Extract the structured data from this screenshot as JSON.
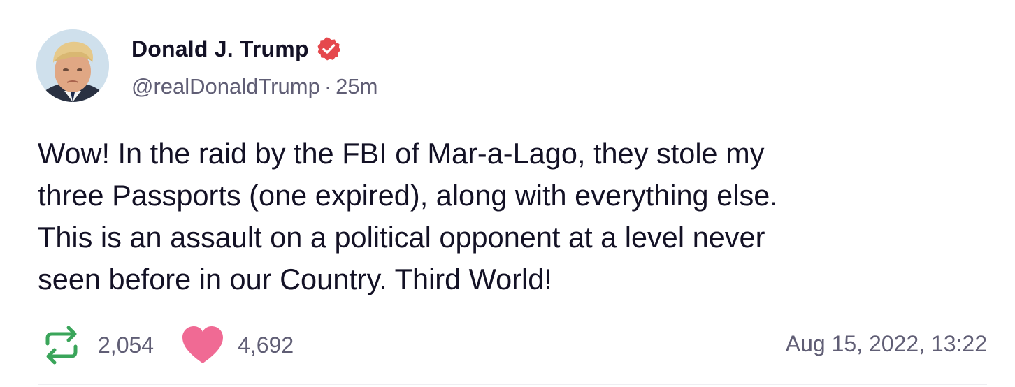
{
  "post": {
    "author": {
      "display_name": "Donald J. Trump",
      "handle": "@realDonaldTrump",
      "verified": true,
      "verified_icon": "verified-badge-icon",
      "avatar": "profile-photo"
    },
    "relative_time": "25m",
    "separator": "·",
    "text": "Wow! In the raid by the FBI of Mar-a-Lago, they stole my\nthree Passports (one expired), along with everything else.\nThis is an assault on a political opponent at a level never\nseen before in our Country. Third World!",
    "stats": {
      "reposts": "2,054",
      "repost_icon": "repost-icon",
      "likes": "4,692",
      "like_icon": "heart-icon"
    },
    "timestamp": "Aug 15, 2022, 13:22"
  },
  "colors": {
    "text_primary": "#131125",
    "text_secondary": "#605e75",
    "verified_badge": "#e5484d",
    "repost_green": "#3aa55a",
    "like_pink": "#f06a94"
  }
}
